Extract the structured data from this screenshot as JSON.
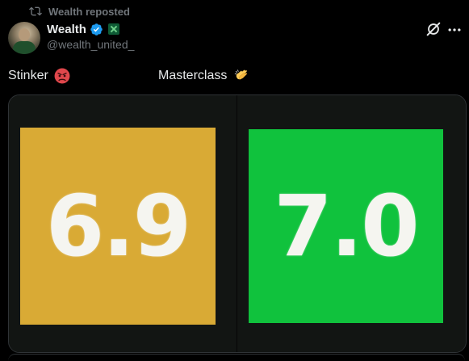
{
  "repost": {
    "text": "Wealth reposted",
    "icon": "repost-icon"
  },
  "author": {
    "name": "Wealth",
    "handle": "@wealth_united_",
    "verified_icon": "verified-badge-icon",
    "affiliate_icon": "affiliate-badge-icon",
    "avatar": "avatar"
  },
  "actions": {
    "grok_icon": "grok-icon",
    "more_icon": "more-icon"
  },
  "tweet": {
    "left_text": "Stinker",
    "left_emoji": "angry-face-emoji",
    "right_text": "Masterclass",
    "right_emoji": "clapping-hands-emoji"
  },
  "media": {
    "left_rating": "6.9",
    "right_rating": "7.0",
    "colors": {
      "left_tile": "#d9aa35",
      "right_tile": "#10c23d",
      "panel_bg": "#121513"
    }
  }
}
